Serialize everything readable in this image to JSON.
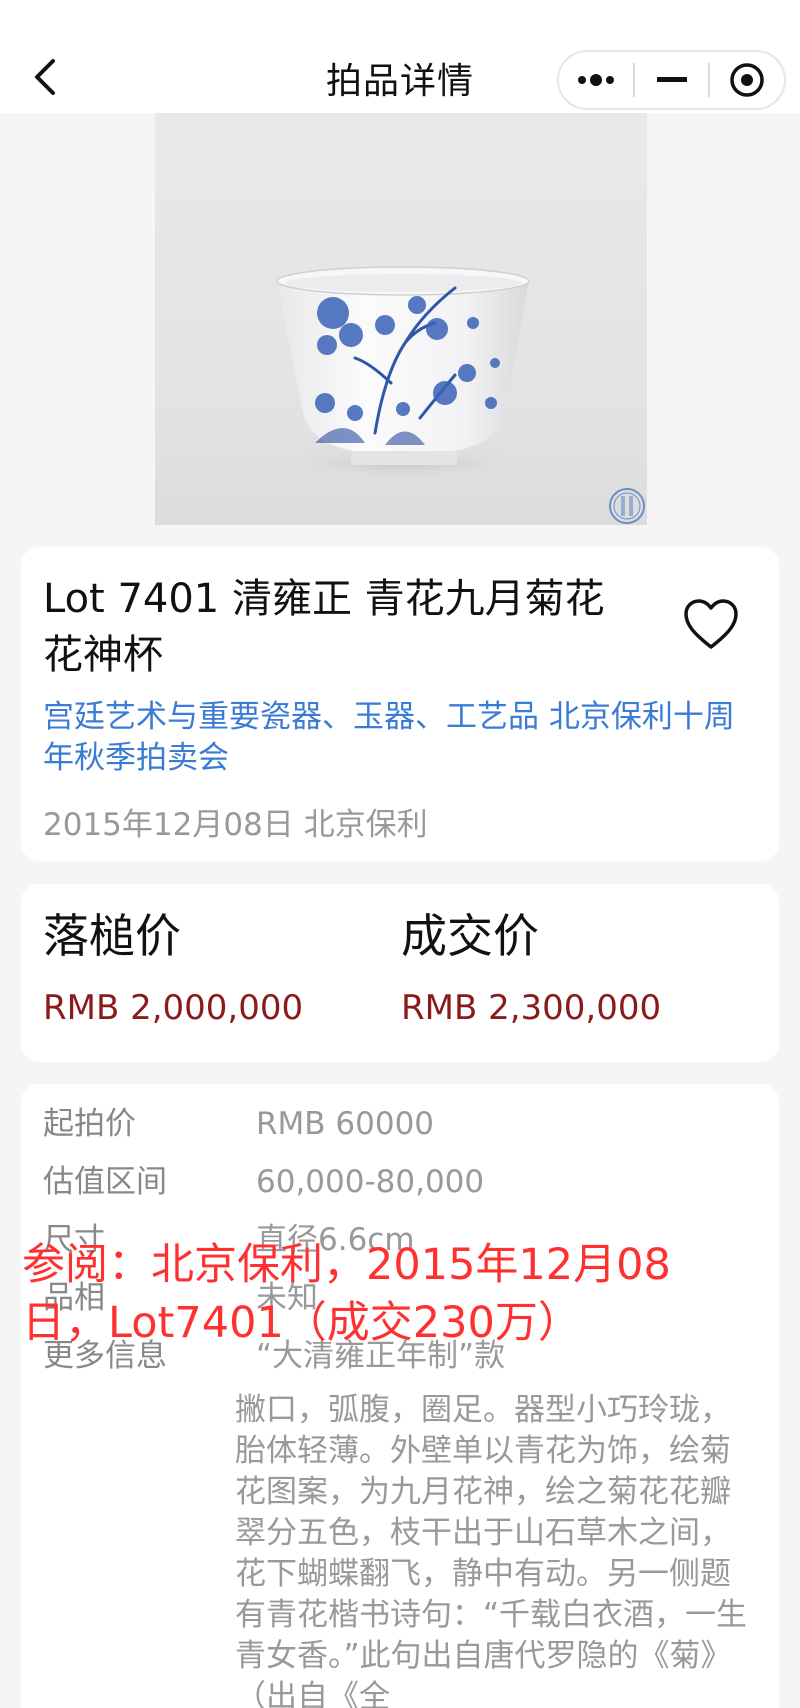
{
  "nav": {
    "title": "拍品详情"
  },
  "lot": {
    "title": "Lot 7401 清雍正 青花九月菊花花神杯",
    "auction": "宫廷艺术与重要瓷器、玉器、工艺品 北京保利十周年秋季拍卖会",
    "date_house": "2015年12月08日 北京保利"
  },
  "prices": {
    "hammer_label": "落槌价",
    "hammer_value": "RMB 2,000,000",
    "deal_label": "成交价",
    "deal_value": "RMB 2,300,000"
  },
  "details": {
    "start_label": "起拍价",
    "start_value": "RMB 60000",
    "estimate_label": "估值区间",
    "estimate_value": "60,000-80,000",
    "size_label": "尺寸",
    "size_value": "直径6.6cm",
    "condition_label": "品相",
    "condition_value": "未知",
    "more_label": "更多信息",
    "more_first_line": "“大清雍正年制”款",
    "more_body": "撇口，弧腹，圈足。器型小巧玲珑，胎体轻薄。外壁单以青花为饰，绘菊花图案，为九月花神，绘之菊花花瓣翠分五色，枝干出于山石草木之间，花下蝴蝶翻飞，静中有动。另一侧题有青花楷书诗句：“千载白衣酒，一生青女香。”此句出自唐代罗隐的《菊》（出自《全"
  },
  "overlay_text": "参阅：北京保利，2015年12月08日，Lot7401（成交230万）",
  "colors": {
    "accent_link": "#3a7bd5",
    "price_red": "#8b1a1a",
    "overlay_red": "#ff3030",
    "page_bg": "#f5f5f5"
  },
  "icons": {
    "back": "chevron-left-icon",
    "menu": "more-dots-icon",
    "minimize": "minus-icon",
    "close": "target-circle-icon",
    "favorite": "heart-outline-icon"
  }
}
